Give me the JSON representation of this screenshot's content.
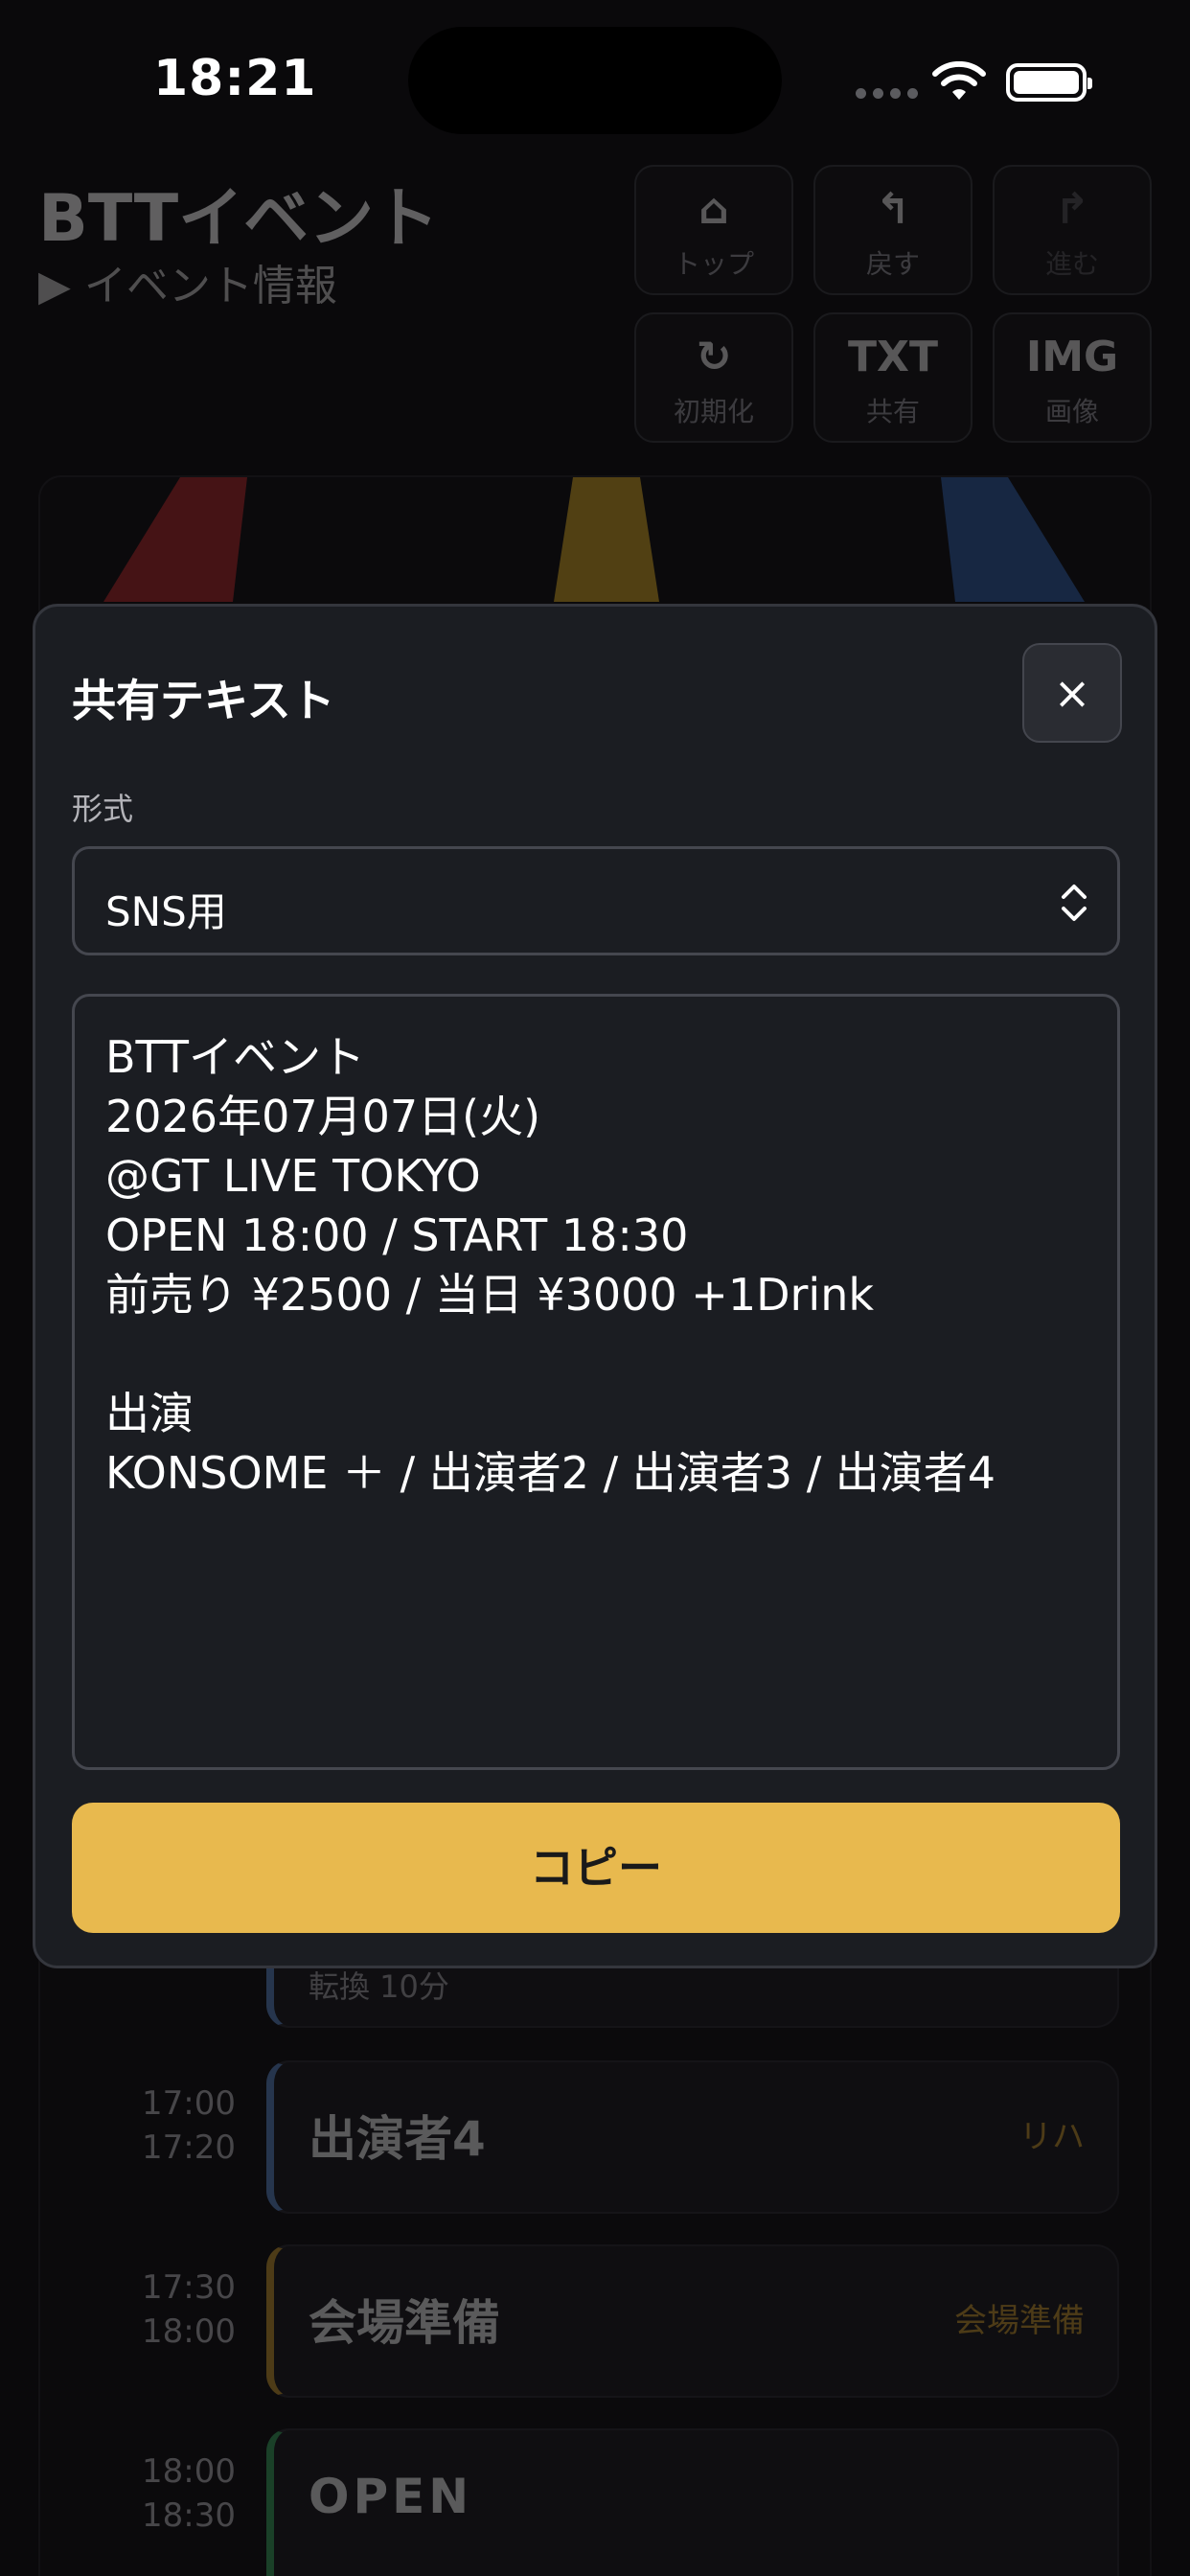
{
  "status": {
    "time": "18:21"
  },
  "header": {
    "title": "BTTイベント",
    "subtitle": "▶ イベント情報"
  },
  "toolbar": {
    "top": {
      "icon": "⌂",
      "label": "トップ"
    },
    "back": {
      "icon": "↰",
      "label": "戻す"
    },
    "forward": {
      "icon": "↱",
      "label": "進む"
    },
    "reset": {
      "icon": "↻",
      "label": "初期化"
    },
    "share": {
      "icon": "TXT",
      "label": "共有"
    },
    "image": {
      "icon": "IMG",
      "label": "画像"
    }
  },
  "timeline": {
    "partial_card": {
      "sub": "転換 10分"
    },
    "rows": [
      {
        "start": "17:00",
        "end": "17:20",
        "title": "出演者4",
        "tag": "リハ",
        "accent": "#5b87c7"
      },
      {
        "start": "17:30",
        "end": "18:00",
        "title": "会場準備",
        "tag": "会場準備",
        "accent": "#c99a2e"
      },
      {
        "start": "18:00",
        "end": "18:30",
        "title": "OPEN",
        "tag": "",
        "accent": "#3aa860"
      }
    ]
  },
  "modal": {
    "title": "共有テキスト",
    "close_label": "×",
    "format_label": "形式",
    "format_value": "SNS用",
    "text_lines": [
      "BTTイベント",
      "2026年07月07日(火)",
      "@GT LIVE TOKYO",
      "OPEN 18:00 / START 18:30",
      "前売り ¥2500 / 当日 ¥3000 +1Drink",
      "",
      "出演",
      "KONSOME ＋ / 出演者2 / 出演者3 / 出演者4"
    ],
    "copy_label": "コピー"
  },
  "colors": {
    "accent_yellow": "#e8b94e",
    "beam_red": "#b3262a",
    "beam_yellow": "#d6a724",
    "beam_blue": "#2f5fa8"
  }
}
